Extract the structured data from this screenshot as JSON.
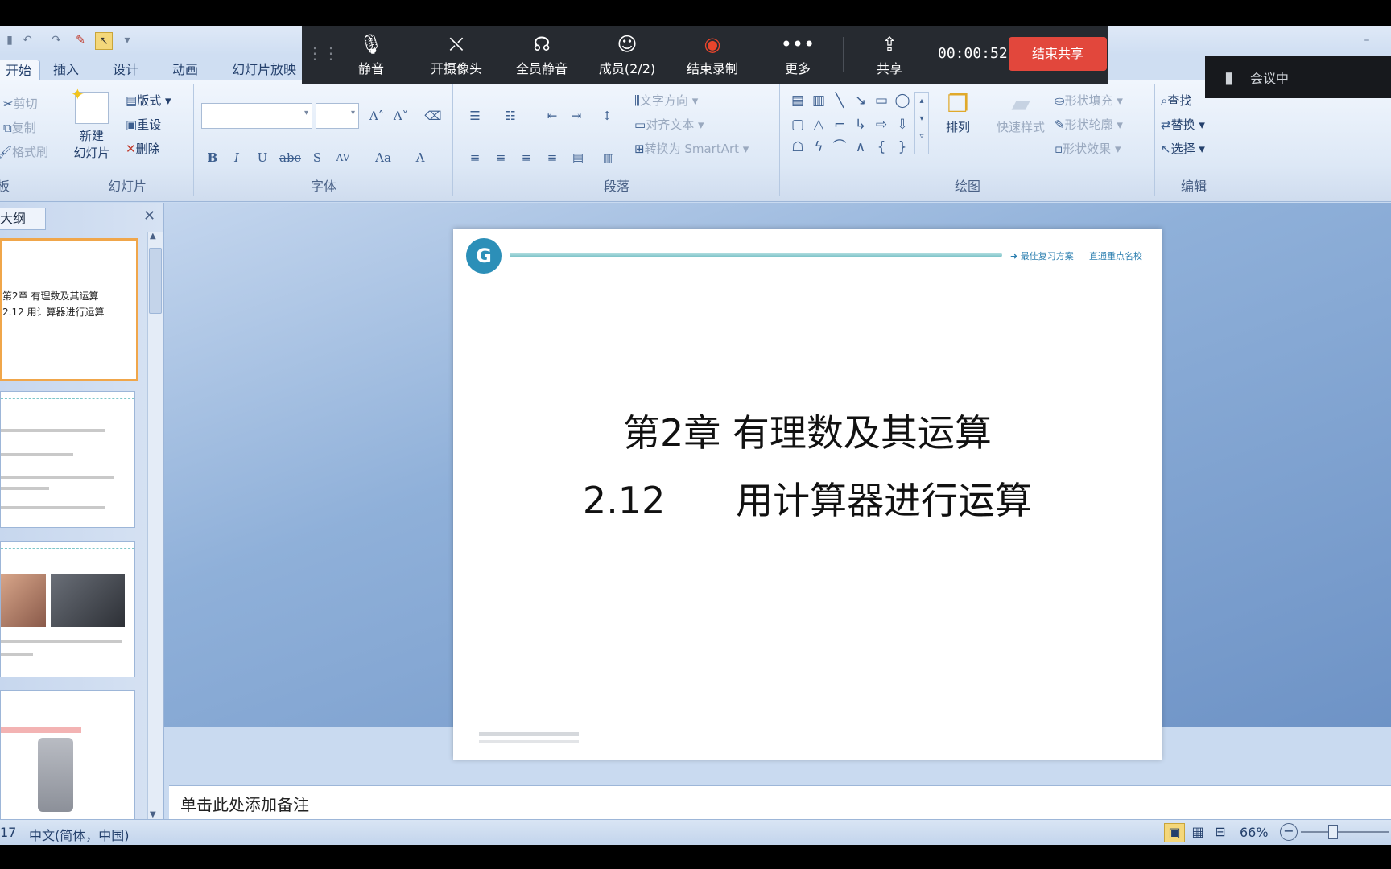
{
  "meeting_bar": {
    "mute": "静音",
    "camera": "开摄像头",
    "mute_all": "全员静音",
    "members": "成员(2/2)",
    "end_recording": "结束录制",
    "more": "更多",
    "share": "共享",
    "timer": "00:00:52",
    "end_share": "结束共享",
    "status": "会议中"
  },
  "tabs": [
    "开始",
    "插入",
    "设计",
    "动画",
    "幻灯片放映"
  ],
  "ribbon": {
    "clipboard": {
      "cut": "剪切",
      "copy": "复制",
      "format_painter": "格式刷",
      "title": "板"
    },
    "slides": {
      "new_slide_line1": "新建",
      "new_slide_line2": "幻灯片",
      "layout": "版式",
      "reset": "重设",
      "delete": "删除",
      "title": "幻灯片"
    },
    "font": {
      "title": "字体"
    },
    "paragraph": {
      "text_direction": "文字方向",
      "align_text": "对齐文本",
      "smartart": "转换为 SmartArt",
      "title": "段落"
    },
    "drawing": {
      "arrange": "排列",
      "quick_styles": "快速样式",
      "shape_fill": "形状填充",
      "shape_outline": "形状轮廓",
      "shape_effects": "形状效果",
      "title": "绘图"
    },
    "editing": {
      "find": "查找",
      "replace": "替换",
      "select": "选择",
      "title": "编辑"
    }
  },
  "left_panel": {
    "tab_label": "大纲",
    "thumb1_line1": "第2章  有理数及其运算",
    "thumb1_line2": "2.12      用计算器进行运算"
  },
  "slide": {
    "header_right1": "➜ 最佳复习方案",
    "header_right2": "直通重点名校",
    "title_line1": "第2章  有理数及其运算",
    "title_line2": "2.12      用计算器进行运算"
  },
  "notes_placeholder": "单击此处添加备注",
  "status": {
    "slide_count": "17",
    "language": "中文(简体，中国)",
    "zoom": "66%"
  },
  "colors": {
    "meeting_bar": "#262a30",
    "end_share": "#e2473c",
    "record": "#e8452c",
    "ribbon_text": "#24406c"
  }
}
